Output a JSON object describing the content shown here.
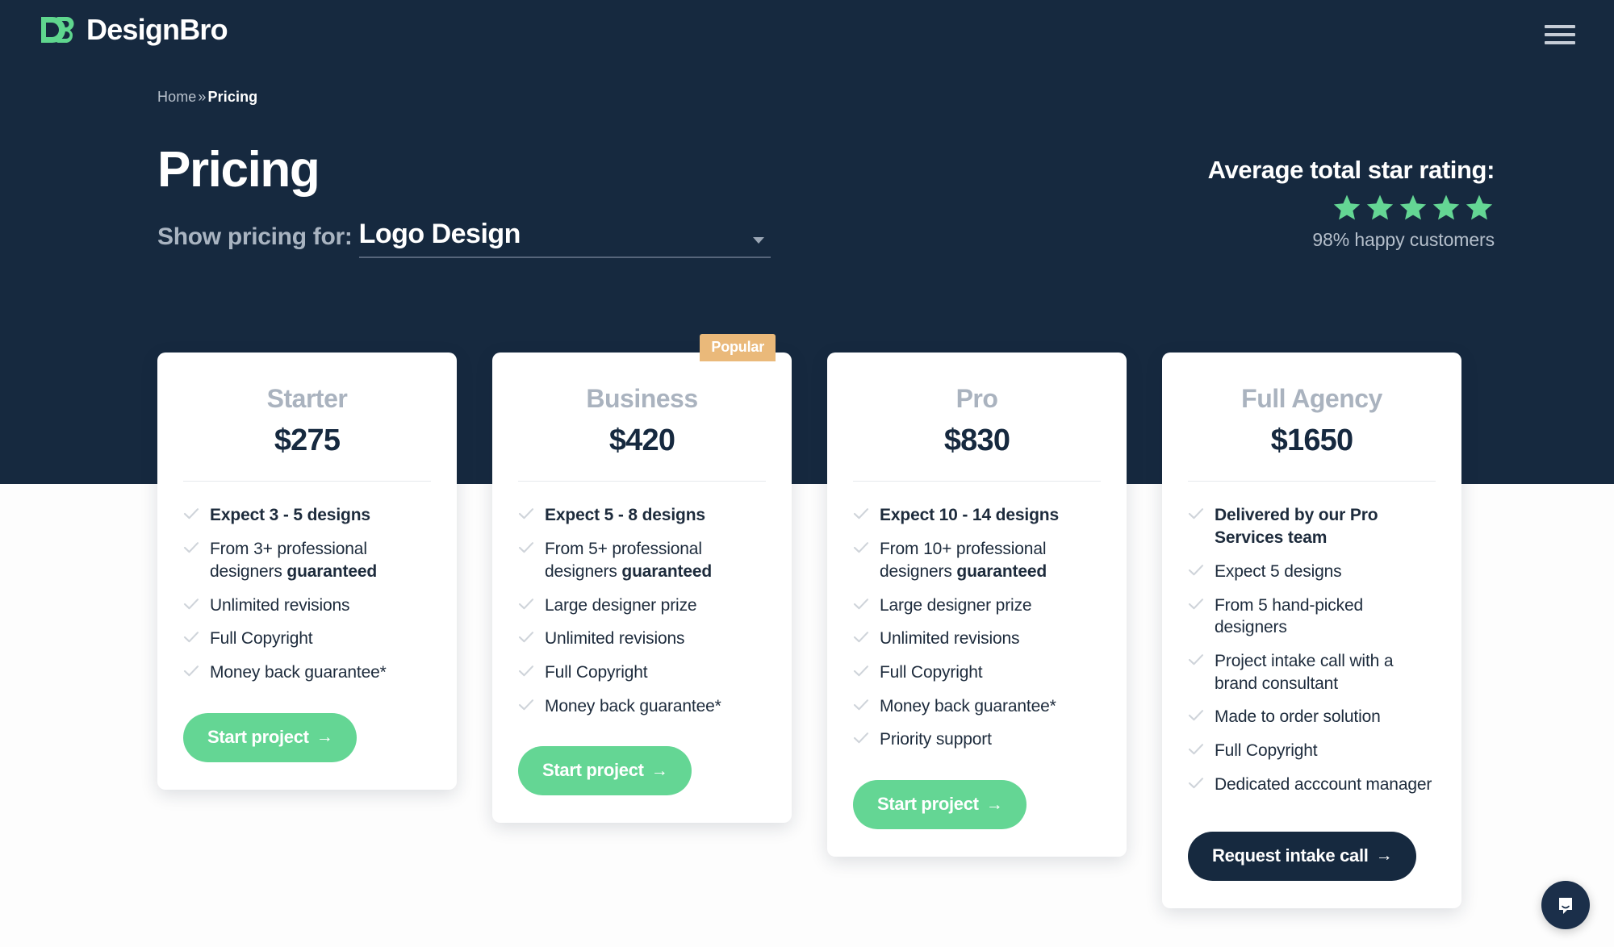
{
  "brand": {
    "name": "DesignBro",
    "logo_icon": "db-monogram-icon",
    "accent_green": "#64d694",
    "hero_bg": "#16293f",
    "badge_color": "#eab97a"
  },
  "topbar": {
    "menu_icon": "hamburger-menu-icon"
  },
  "breadcrumb": {
    "home": "Home",
    "separator": "»",
    "current": "Pricing"
  },
  "hero": {
    "title": "Pricing",
    "selector_label": "Show pricing for:",
    "selected_service": "Logo Design",
    "caret_icon": "chevron-down-icon",
    "rating_title": "Average total star rating:",
    "stars": 5,
    "star_icon": "star-icon",
    "rating_subtitle": "98% happy customers"
  },
  "plans": [
    {
      "name": "Starter",
      "price": "$275",
      "badge": null,
      "features": [
        {
          "text": "Expect 3 - 5 designs",
          "bold": true
        },
        {
          "text": "From 3+ professional designers ",
          "bold": false,
          "bold_tail": "guaranteed"
        },
        {
          "text": "Unlimited revisions",
          "bold": false
        },
        {
          "text": "Full Copyright",
          "bold": false
        },
        {
          "text": "Money back guarantee*",
          "bold": false
        }
      ],
      "cta": "Start project",
      "cta_arrow": "→",
      "cta_style": "green"
    },
    {
      "name": "Business",
      "price": "$420",
      "badge": "Popular",
      "features": [
        {
          "text": "Expect 5 - 8 designs",
          "bold": true
        },
        {
          "text": "From 5+ professional designers ",
          "bold": false,
          "bold_tail": "guaranteed"
        },
        {
          "text": "Large designer prize",
          "bold": false
        },
        {
          "text": "Unlimited revisions",
          "bold": false
        },
        {
          "text": "Full Copyright",
          "bold": false
        },
        {
          "text": "Money back guarantee*",
          "bold": false
        }
      ],
      "cta": "Start project",
      "cta_arrow": "→",
      "cta_style": "green"
    },
    {
      "name": "Pro",
      "price": "$830",
      "badge": null,
      "features": [
        {
          "text": "Expect 10 - 14 designs",
          "bold": true
        },
        {
          "text": "From 10+ professional designers ",
          "bold": false,
          "bold_tail": "guaranteed"
        },
        {
          "text": "Large designer prize",
          "bold": false
        },
        {
          "text": "Unlimited revisions",
          "bold": false
        },
        {
          "text": "Full Copyright",
          "bold": false
        },
        {
          "text": "Money back guarantee*",
          "bold": false
        },
        {
          "text": "Priority support",
          "bold": false
        }
      ],
      "cta": "Start project",
      "cta_arrow": "→",
      "cta_style": "green"
    },
    {
      "name": "Full Agency",
      "price": "$1650",
      "badge": null,
      "features": [
        {
          "text": "Delivered by our Pro Services team",
          "bold": true
        },
        {
          "text": "Expect 5 designs",
          "bold": false
        },
        {
          "text": "From 5 hand-picked designers",
          "bold": false
        },
        {
          "text": "Project intake call with a brand consultant",
          "bold": false
        },
        {
          "text": "Made to order solution",
          "bold": false
        },
        {
          "text": "Full Copyright",
          "bold": false
        },
        {
          "text": "Dedicated acccount manager",
          "bold": false
        }
      ],
      "cta": "Request intake call",
      "cta_arrow": "→",
      "cta_style": "dark"
    }
  ],
  "chat": {
    "icon": "chat-bubble-icon"
  }
}
